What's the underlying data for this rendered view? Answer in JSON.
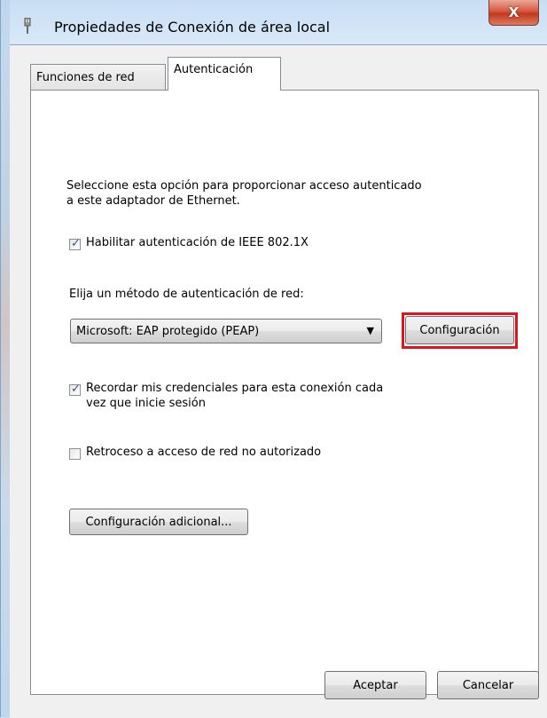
{
  "window": {
    "title": "Propiedades de Conexión de área local",
    "close_label": "X"
  },
  "tabs": [
    {
      "label": "Funciones de red",
      "active": false
    },
    {
      "label": "Autenticación",
      "active": true
    }
  ],
  "auth": {
    "description_line1": "Seleccione esta opción para proporcionar acceso autenticado",
    "description_line2": "a este adaptador de Ethernet.",
    "enable_8021x": {
      "label": "Habilitar autenticación de IEEE 802.1X",
      "checked": true
    },
    "method_label": "Elija un método de autenticación de red:",
    "method_selected": "Microsoft: EAP protegido (PEAP)",
    "config_button": "Configuración",
    "remember": {
      "label_line1": "Recordar mis credenciales para esta conexión cada",
      "label_line2": "vez que inicie sesión",
      "checked": true
    },
    "fallback": {
      "label": "Retroceso a acceso de red no autorizado",
      "checked": false
    },
    "additional_button": "Configuración adicional..."
  },
  "footer": {
    "ok_label": "Aceptar",
    "cancel_label": "Cancelar"
  },
  "colors": {
    "highlight": "#e0141e",
    "close_button": "#c1381e",
    "check_mark": "#3b4f9c"
  },
  "icons": {
    "app": "network-adapter-icon",
    "dropdown": "chevron-down-icon",
    "check": "checkmark-icon"
  }
}
